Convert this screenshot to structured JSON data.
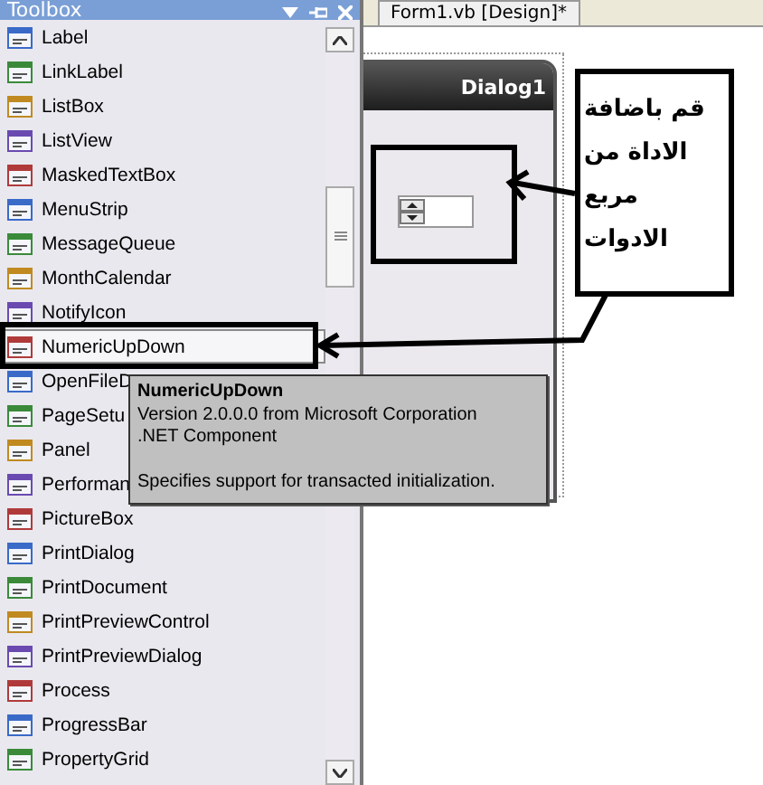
{
  "toolbox": {
    "title": "Toolbox",
    "items": [
      {
        "label": "Label",
        "selected": false
      },
      {
        "label": "LinkLabel",
        "selected": false
      },
      {
        "label": "ListBox",
        "selected": false
      },
      {
        "label": "ListView",
        "selected": false
      },
      {
        "label": "MaskedTextBox",
        "selected": false
      },
      {
        "label": "MenuStrip",
        "selected": false
      },
      {
        "label": "MessageQueue",
        "selected": false
      },
      {
        "label": "MonthCalendar",
        "selected": false
      },
      {
        "label": "NotifyIcon",
        "selected": false
      },
      {
        "label": "NumericUpDown",
        "selected": true
      },
      {
        "label": "OpenFileD",
        "selected": false
      },
      {
        "label": "PageSetu",
        "selected": false
      },
      {
        "label": "Panel",
        "selected": false
      },
      {
        "label": "Performan",
        "selected": false
      },
      {
        "label": "PictureBox",
        "selected": false
      },
      {
        "label": "PrintDialog",
        "selected": false
      },
      {
        "label": "PrintDocument",
        "selected": false
      },
      {
        "label": "PrintPreviewControl",
        "selected": false
      },
      {
        "label": "PrintPreviewDialog",
        "selected": false
      },
      {
        "label": "Process",
        "selected": false
      },
      {
        "label": "ProgressBar",
        "selected": false
      },
      {
        "label": "PropertyGrid",
        "selected": false
      }
    ]
  },
  "document_tab": {
    "label": "Form1.vb [Design]*"
  },
  "form": {
    "title": "Dialog1"
  },
  "tooltip": {
    "title": "NumericUpDown",
    "lines": [
      "Version 2.0.0.0 from Microsoft Corporation",
      ".NET Component"
    ],
    "description": "Specifies support for transacted initialization."
  },
  "annotation": {
    "lines": [
      "قم باضافة",
      "الاداة من",
      "مربع",
      "الادوات"
    ]
  }
}
